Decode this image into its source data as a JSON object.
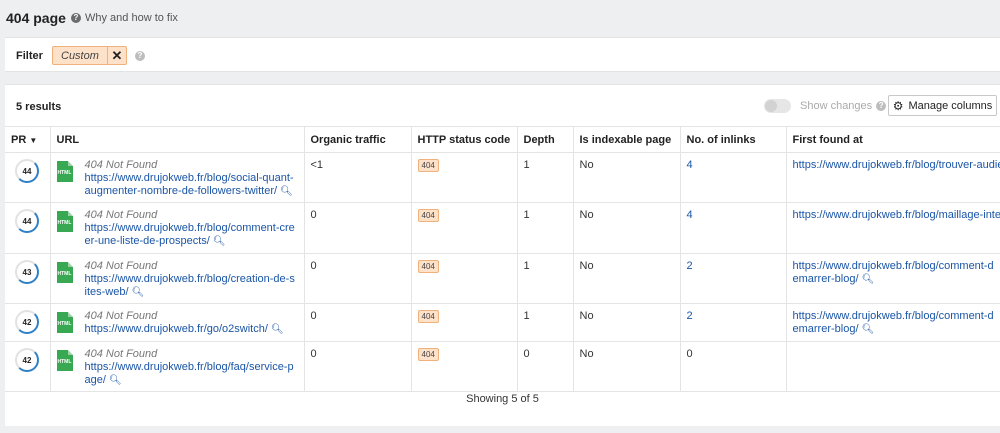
{
  "header": {
    "title": "404 page",
    "help_text": "Why and how to fix"
  },
  "filter": {
    "label": "Filter",
    "chip_label": "Custom"
  },
  "toolbar": {
    "results": "5 results",
    "show_changes": "Show changes",
    "manage_columns": "Manage columns"
  },
  "table": {
    "columns": [
      "PR",
      "URL",
      "Organic traffic",
      "HTTP status code",
      "Depth",
      "Is indexable page",
      "No. of inlinks",
      "First found at"
    ],
    "rows": [
      {
        "pr": "44",
        "status_text": "404 Not Found",
        "url": "https://www.drujokweb.fr/blog/social-quant-augmenter-nombre-de-followers-twitter/",
        "organic_traffic": "<1",
        "http_status": "404",
        "depth": "1",
        "indexable": "No",
        "inlinks": "4",
        "first_found": "https://www.drujokweb.fr/blog/trouver-audience"
      },
      {
        "pr": "44",
        "status_text": "404 Not Found",
        "url": "https://www.drujokweb.fr/blog/comment-creer-une-liste-de-prospects/",
        "organic_traffic": "0",
        "http_status": "404",
        "depth": "1",
        "indexable": "No",
        "inlinks": "4",
        "first_found": "https://www.drujokweb.fr/blog/maillage-interne"
      },
      {
        "pr": "43",
        "status_text": "404 Not Found",
        "url": "https://www.drujokweb.fr/blog/creation-de-sites-web/",
        "organic_traffic": "0",
        "http_status": "404",
        "depth": "1",
        "indexable": "No",
        "inlinks": "2",
        "first_found": "https://www.drujokweb.fr/blog/comment-demarrer-blog/"
      },
      {
        "pr": "42",
        "status_text": "404 Not Found",
        "url": "https://www.drujokweb.fr/go/o2switch/",
        "organic_traffic": "0",
        "http_status": "404",
        "depth": "1",
        "indexable": "No",
        "inlinks": "2",
        "first_found": "https://www.drujokweb.fr/blog/comment-demarrer-blog/"
      },
      {
        "pr": "42",
        "status_text": "404 Not Found",
        "url": "https://www.drujokweb.fr/blog/faq/service-page/",
        "organic_traffic": "0",
        "http_status": "404",
        "depth": "0",
        "indexable": "No",
        "inlinks": "0",
        "first_found": ""
      }
    ],
    "footer": "Showing 5 of 5"
  },
  "colors": {
    "link": "#1a55a6",
    "badge_bg": "#fde1c8",
    "badge_border": "#f0b27d",
    "file_icon": "#38a852",
    "pr_ring": "#2f80c6"
  },
  "icons": {
    "help": "question-circle-icon",
    "close": "close-icon",
    "gear": "gear-icon",
    "sort": "sort-down-icon",
    "file": "html-file-icon",
    "search": "magnifier-icon"
  }
}
